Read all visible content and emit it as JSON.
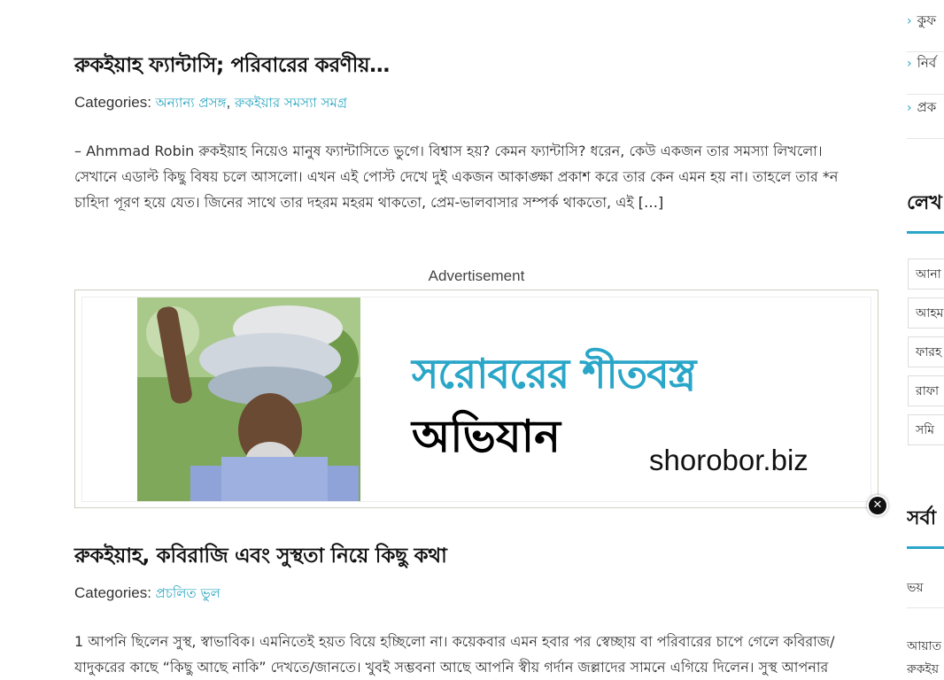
{
  "posts": [
    {
      "title": "রুকইয়াহ ফ্যান্টাসি; পরিবারের করণীয়…",
      "categories_label": "Categories:",
      "categories": [
        "অন্যান্য প্রসঙ্গ",
        "রুকইয়ার সমস্যা সমগ্র"
      ],
      "excerpt_lines": [
        "– Ahmmad Robin রুকইয়াহ নিয়েও মানুষ ফ্যান্টাসিতে ভুগে। বিশ্বাস হয়? কেমন ফ্যান্টাসি? ধরেন, কেউ একজন তার সমস্যা লিখলো।",
        "সেখানে এডাল্ট কিছু বিষয় চলে আসলো। এখন এই পোস্ট দেখে দুই একজন আকাঙ্ক্ষা প্রকাশ করে তার কেন এমন হয় না। তাহলে তার *ন",
        "চাহিদা পূরণ হয়ে যেত। জিনের সাথে তার দহরম মহরম থাকতো, প্রেম-ভালবাসার সম্পর্ক থাকতো, এই"
      ],
      "read_more": "[…]"
    },
    {
      "title": "রুকইয়াহ, কবিরাজি এবং সুস্থতা নিয়ে কিছু কথা",
      "categories_label": "Categories:",
      "categories": [
        "প্রচলিত ভুল"
      ],
      "excerpt_lines": [
        "1 আপনি ছিলেন সুস্থ, স্বাভাবিক। এমনিতেই হয়ত বিয়ে হচ্ছিলো না। কয়েকবার এমন হবার পর স্বেচ্ছায় বা পরিবারের চাপে গেলে কবিরাজ/",
        "যাদুকরের কাছে “কিছু আছে নাকি” দেখতে/জানতে। খুবই সম্ভবনা আছে আপনি স্বীয় গর্দান জল্লাদের সামনে এগিয়ে দিলেন। সুস্থ আপনার"
      ]
    }
  ],
  "ad": {
    "label": "Advertisement",
    "headline": "সরোবরের শীতবস্ত্র",
    "subheadline": "অভিযান",
    "url": "shorobor.biz",
    "close_icon": "close-icon",
    "accent_color": "#2aa6c8"
  },
  "sidebar": {
    "links": [
      "কুফ",
      "নির্ব",
      "প্রক"
    ],
    "section1_title": "লেখ",
    "tags": [
      "আনা",
      "আহম",
      "ফারহ",
      "রাফা",
      "সমি"
    ],
    "section2_title": "সর্বা",
    "items": [
      "ভয়",
      "আয়াত",
      "রুকইয়"
    ]
  },
  "colors": {
    "link": "#2aa6bf",
    "text": "#333333",
    "heading": "#111111"
  }
}
